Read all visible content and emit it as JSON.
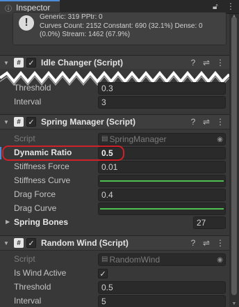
{
  "tab": {
    "title": "Inspector",
    "icon": "info-icon"
  },
  "stats": {
    "lines": [
      "Generic: 319 PPtr: 0",
      "Curves Count: 2152 Constant: 690 (32.1%) Dense: 0",
      "(0.0%) Stream: 1462 (67.9%)"
    ]
  },
  "components": {
    "idle_changer": {
      "title": "Idle Changer (Script)",
      "fields": [
        {
          "label": "Threshold",
          "value": "0.3"
        },
        {
          "label": "Interval",
          "value": "3"
        }
      ]
    },
    "spring_manager": {
      "title": "Spring Manager (Script)",
      "script_label": "Script",
      "script_value": "SpringManager",
      "dynamic_ratio": {
        "label": "Dynamic Ratio",
        "value": "0.5"
      },
      "stiffness_force": {
        "label": "Stiffness Force",
        "value": "0.01"
      },
      "stiffness_curve": {
        "label": "Stiffness Curve"
      },
      "drag_force": {
        "label": "Drag Force",
        "value": "0.4"
      },
      "drag_curve": {
        "label": "Drag Curve"
      },
      "spring_bones": {
        "label": "Spring Bones",
        "value": "27"
      }
    },
    "random_wind": {
      "title": "Random Wind (Script)",
      "script_label": "Script",
      "script_value": "RandomWind",
      "is_wind_active": {
        "label": "Is Wind Active",
        "checked": true
      },
      "threshold": {
        "label": "Threshold",
        "value": "0.5"
      },
      "interval": {
        "label": "Interval",
        "value": "5"
      }
    }
  },
  "colors": {
    "curve": "#4fc14f",
    "highlight": "#d0202a",
    "accent": "#4d8cd6"
  }
}
